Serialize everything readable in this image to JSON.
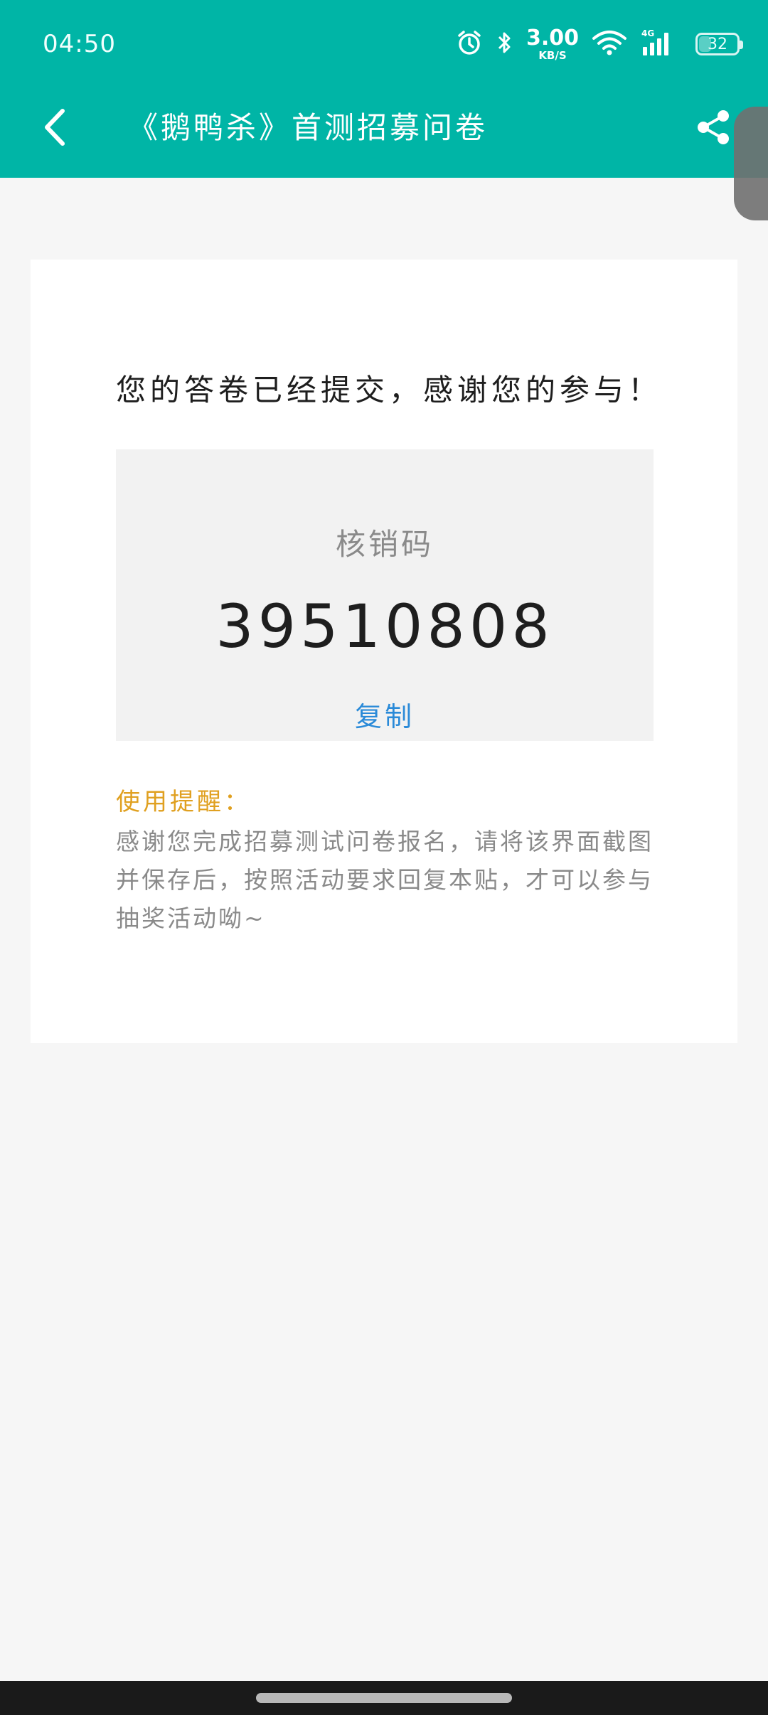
{
  "status_bar": {
    "time": "04:50",
    "net_speed_value": "3.00",
    "net_speed_unit": "KB/S",
    "network_type": "4G",
    "battery_level": "32",
    "battery_fraction": 0.32
  },
  "header": {
    "title": "《鹅鸭杀》首测招募问卷",
    "background_color": "#00b5a6"
  },
  "result": {
    "message": "您的答卷已经提交，感谢您的参与！",
    "code_label": "核销码",
    "code_value": "39510808",
    "copy_label": "复制"
  },
  "tips": {
    "title": "使用提醒：",
    "body": "感谢您完成招募测试问卷报名，请将该界面截图并保存后，按照活动要求回复本贴，才可以参与抽奖活动呦~"
  },
  "colors": {
    "accent": "#00b5a6",
    "link": "#2a8ad8",
    "tip_title": "#e0a020"
  }
}
